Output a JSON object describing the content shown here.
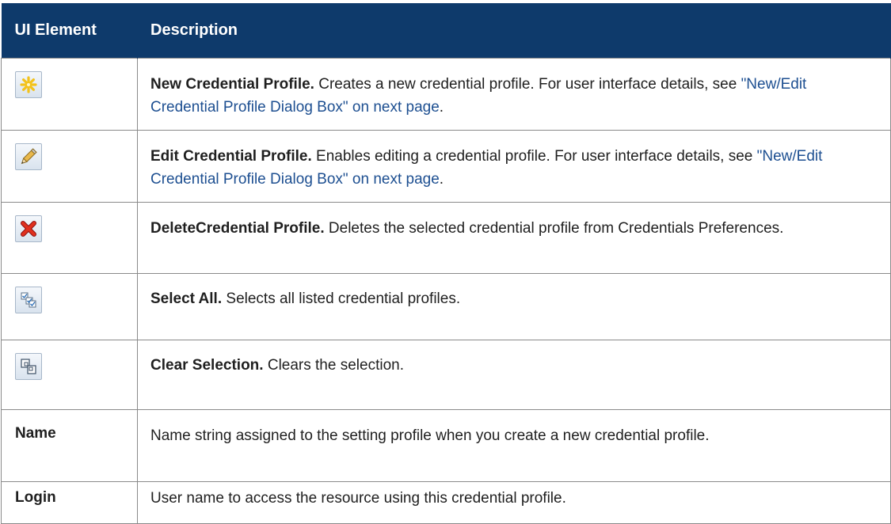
{
  "table": {
    "header": {
      "col1": "UI Element",
      "col2": "Description"
    },
    "rows": [
      {
        "icon": "new-credential-icon",
        "term": "New Credential Profile.",
        "text": " Creates a new credential profile. For user interface details, see ",
        "link": "\"New/Edit Credential Profile Dialog Box\" on next page",
        "after": "."
      },
      {
        "icon": "edit-pencil-icon",
        "term": "Edit Credential Profile.",
        "text": " Enables editing a credential profile. For user interface details, see ",
        "link": "\"New/Edit Credential Profile Dialog Box\" on next page",
        "after": "."
      },
      {
        "icon": "delete-x-icon",
        "term": "DeleteCredential Profile.",
        "text": " Deletes the selected credential profile from Credentials Preferences."
      },
      {
        "icon": "select-all-icon",
        "term": "Select All.",
        "text": " Selects all listed credential profiles."
      },
      {
        "icon": "clear-selection-icon",
        "term": "Clear Selection.",
        "text": " Clears the selection."
      },
      {
        "label": "Name",
        "text": "Name string assigned to the setting profile when you create a new credential profile."
      },
      {
        "label": "Login",
        "text": "User name to access the resource using this credential profile."
      }
    ]
  },
  "colors": {
    "header_bg": "#0e3a6b",
    "link": "#1d4f91",
    "border": "#8a8a8a"
  }
}
